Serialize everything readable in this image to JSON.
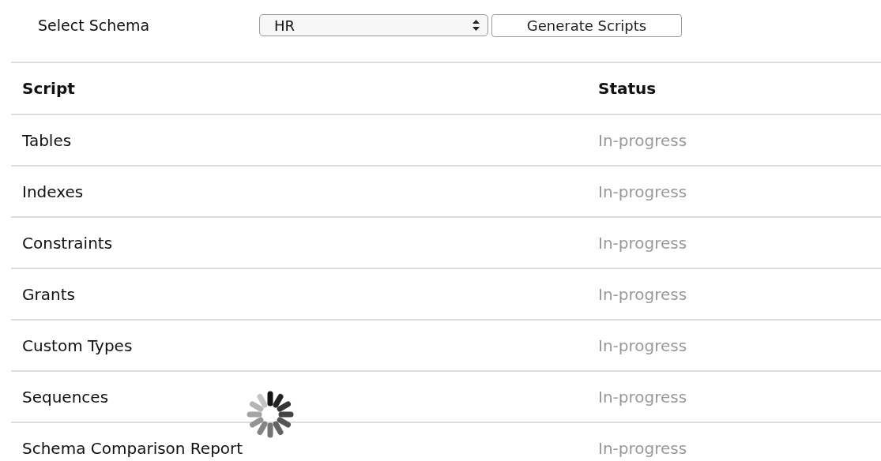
{
  "schema_selector": {
    "label": "Select Schema",
    "value": "HR",
    "button": "Generate Scripts"
  },
  "table": {
    "columns": [
      "Script",
      "Status"
    ],
    "rows": [
      {
        "script": "Tables",
        "status": "In-progress"
      },
      {
        "script": "Indexes",
        "status": "In-progress"
      },
      {
        "script": "Constraints",
        "status": "In-progress"
      },
      {
        "script": "Grants",
        "status": "In-progress"
      },
      {
        "script": "Custom Types",
        "status": "In-progress"
      },
      {
        "script": "Sequences",
        "status": "In-progress"
      },
      {
        "script": "Schema Comparison Report",
        "status": "In-progress"
      }
    ]
  }
}
